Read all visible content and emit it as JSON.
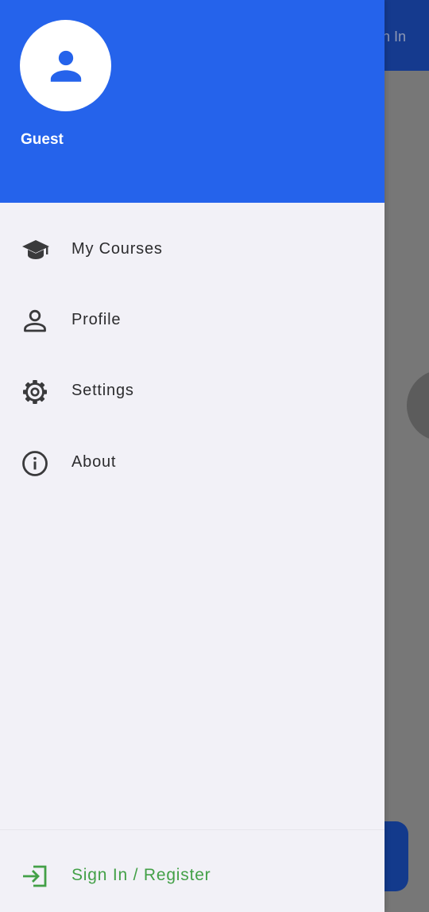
{
  "background": {
    "app_bar_action_label": "Sign In",
    "colors": {
      "app_bar": "#153a8e",
      "scrim": "#757575",
      "fab": "#133a8c"
    }
  },
  "drawer": {
    "header": {
      "user_name": "Guest",
      "avatar_icon": "person-icon",
      "color": "#2563eb"
    },
    "menu": [
      {
        "label": "My Courses",
        "icon": "graduation-cap-icon"
      },
      {
        "label": "Profile",
        "icon": "person-outline-icon"
      },
      {
        "label": "Settings",
        "icon": "gear-icon"
      },
      {
        "label": "About",
        "icon": "info-icon"
      }
    ],
    "footer": {
      "label": "Sign In / Register",
      "icon": "login-icon",
      "color": "#43a047"
    }
  }
}
